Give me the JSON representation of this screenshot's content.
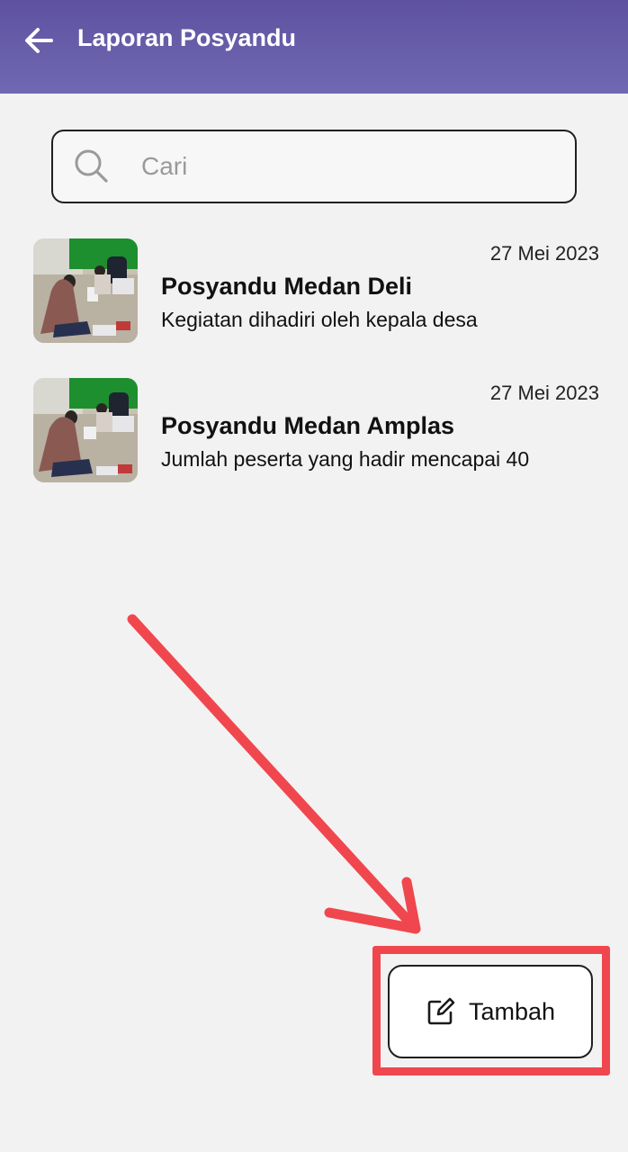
{
  "appbar": {
    "title": "Laporan Posyandu",
    "back_icon": "arrow-left-icon",
    "color": "#6a5fac"
  },
  "search": {
    "placeholder": "Cari",
    "value": "",
    "icon": "search-icon"
  },
  "reports": [
    {
      "date": "27 Mei 2023",
      "title": "Posyandu Medan Deli",
      "description": "Kegiatan dihadiri oleh kepala desa"
    },
    {
      "date": "27 Mei 2023",
      "title": "Posyandu Medan Amplas",
      "description": "Jumlah peserta yang hadir mencapai 40"
    }
  ],
  "add_button": {
    "label": "Tambah",
    "icon": "edit-icon"
  },
  "annotation": {
    "color": "#f0474e"
  }
}
